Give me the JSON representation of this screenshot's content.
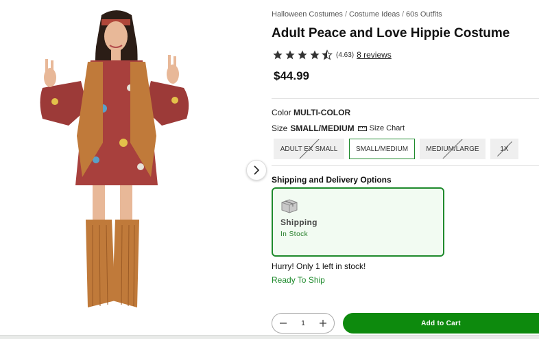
{
  "breadcrumb": {
    "items": [
      "Halloween Costumes",
      "Costume Ideas",
      "60s Outfits"
    ],
    "separator": "/"
  },
  "product": {
    "title": "Adult Peace and Love Hippie Costume",
    "rating_display": "(4.63)",
    "rating_stars": 4.63,
    "reviews_link": "8 reviews",
    "price": "$44.99",
    "image_alt": "product-photo"
  },
  "color": {
    "label": "Color",
    "value": "MULTI-COLOR"
  },
  "size": {
    "label": "Size",
    "value": "SMALL/MEDIUM",
    "chart_link": "Size Chart",
    "options": [
      {
        "label": "ADULT EX SMALL",
        "available": false,
        "selected": false
      },
      {
        "label": "SMALL/MEDIUM",
        "available": true,
        "selected": true
      },
      {
        "label": "MEDIUM/LARGE",
        "available": false,
        "selected": false
      },
      {
        "label": "1X",
        "available": false,
        "selected": false
      }
    ]
  },
  "shipping": {
    "heading": "Shipping and Delivery Options",
    "option_label": "Shipping",
    "option_status": "In Stock"
  },
  "stock": {
    "hurry": "Hurry! Only 1 left in stock!",
    "ready": "Ready To Ship"
  },
  "cart": {
    "quantity": "1",
    "add_label": "Add to Cart"
  },
  "colors": {
    "accent_green": "#1e8a2c",
    "cart_green": "#0d8a0d"
  }
}
